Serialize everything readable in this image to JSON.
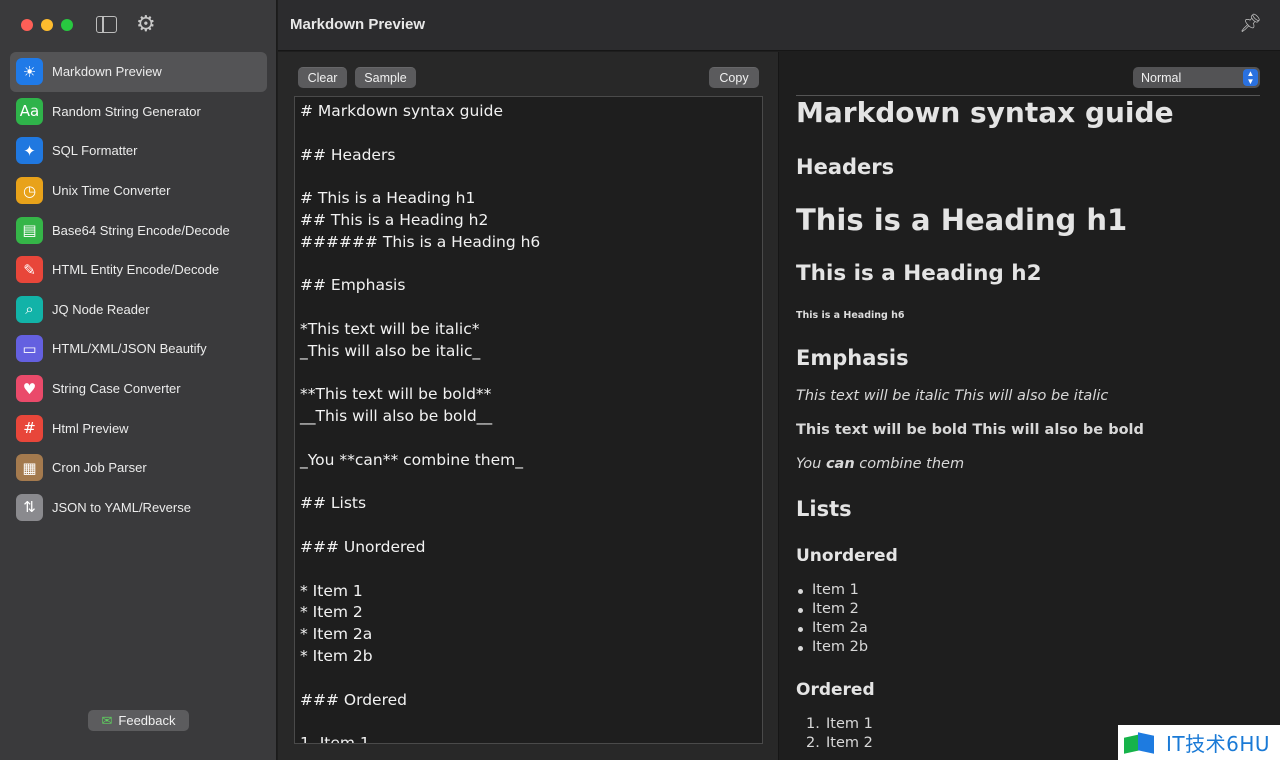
{
  "window": {
    "title": "Markdown Preview"
  },
  "sidebar": {
    "items": [
      {
        "label": "Markdown Preview",
        "icon": "sun-icon",
        "glyph": "☀",
        "color": "#1f7ae8",
        "active": true
      },
      {
        "label": "Random String Generator",
        "icon": "text-aa-icon",
        "glyph": "Aa",
        "color": "#2fb34a"
      },
      {
        "label": "SQL Formatter",
        "icon": "magic-wand-icon",
        "glyph": "✦",
        "color": "#2078e0"
      },
      {
        "label": "Unix Time Converter",
        "icon": "timer-icon",
        "glyph": "◷",
        "color": "#e8a21a"
      },
      {
        "label": "Base64 String Encode/Decode",
        "icon": "message-icon",
        "glyph": "▤",
        "color": "#35b548"
      },
      {
        "label": "HTML Entity Encode/Decode",
        "icon": "feather-icon",
        "glyph": "✎",
        "color": "#e8463a"
      },
      {
        "label": "JQ Node Reader",
        "icon": "magnifier-icon",
        "glyph": "⌕",
        "color": "#12b3a8"
      },
      {
        "label": "HTML/XML/JSON Beautify",
        "icon": "laptop-icon",
        "glyph": "▭",
        "color": "#6460e0"
      },
      {
        "label": "String Case Converter",
        "icon": "heart-icon",
        "glyph": "♥",
        "color": "#ea4a6a"
      },
      {
        "label": "Html Preview",
        "icon": "hash-icon",
        "glyph": "#",
        "color": "#e8463a"
      },
      {
        "label": "Cron Job Parser",
        "icon": "calendar-grid-icon",
        "glyph": "▦",
        "color": "#a47a4e"
      },
      {
        "label": "JSON to YAML/Reverse",
        "icon": "swap-path-icon",
        "glyph": "⇅",
        "color": "#8a8a8e"
      }
    ],
    "feedback_label": "Feedback"
  },
  "editor": {
    "clear_label": "Clear",
    "sample_label": "Sample",
    "copy_label": "Copy",
    "lines": [
      "# Markdown syntax guide",
      "",
      "## Headers",
      "",
      "# This is a Heading h1",
      "## This is a Heading h2",
      "###### This is a Heading h6",
      "",
      "## Emphasis",
      "",
      "*This text will be italic*",
      "_This will also be italic_",
      "",
      "**This text will be bold**",
      "__This will also be bold__",
      "",
      "_You **can** combine them_",
      "",
      "## Lists",
      "",
      "### Unordered",
      "",
      "* Item 1",
      "* Item 2",
      "* Item 2a",
      "* Item 2b",
      "",
      "### Ordered",
      "",
      "1. Item 1"
    ]
  },
  "preview": {
    "mode_select": "Normal",
    "title": "Markdown syntax guide",
    "headers": "Headers",
    "heading_h1": "This is a Heading h1",
    "heading_h2": "This is a Heading h2",
    "heading_h6": "This is a Heading h6",
    "emphasis": "Emphasis",
    "italic_line": "This text will be italic This will also be italic",
    "bold_line": "This text will be bold This will also be bold",
    "combine_a": "You ",
    "combine_b": "can",
    "combine_c": " combine them",
    "lists": "Lists",
    "unordered": "Unordered",
    "unordered_items": [
      "Item 1",
      "Item 2",
      "Item 2a",
      "Item 2b"
    ],
    "ordered": "Ordered",
    "ordered_items": [
      "1.",
      "Item 1",
      "2.",
      "Item 2"
    ]
  },
  "watermark": {
    "text": "IT技术6HU"
  }
}
